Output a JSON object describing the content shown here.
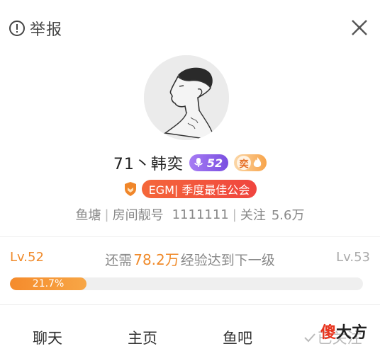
{
  "header": {
    "report_label": "举报",
    "report_icon": "exclamation-circle-icon",
    "close_icon": "close-icon"
  },
  "profile": {
    "name": "71丶韩奕",
    "anchor_level": "52",
    "anchor_level_icon": "microphone-icon",
    "fan_badge_char": "奕",
    "guild_label": "EGM| 季度最佳公会",
    "info": {
      "fishpond_label": "鱼塘",
      "room_label": "房间靓号",
      "room_number": "1111111",
      "follow_label": "关注",
      "follow_count": "5.6万"
    }
  },
  "level_progress": {
    "current_level": "Lv.52",
    "next_level": "Lv.53",
    "prefix": "还需",
    "exp_needed": "78.2万",
    "suffix": "经验达到下一级",
    "percent_label": "21.7%",
    "percent_value": 21.7
  },
  "actions": {
    "chat": "聊天",
    "homepage": "主页",
    "fishbar": "鱼吧",
    "followed": "已关注"
  },
  "watermark": {
    "part1": "傻",
    "part2": "大方"
  },
  "colors": {
    "accent_orange": "#f08a2a",
    "guild_red": "#f0453f",
    "level_purple": "#8a5ce8"
  }
}
